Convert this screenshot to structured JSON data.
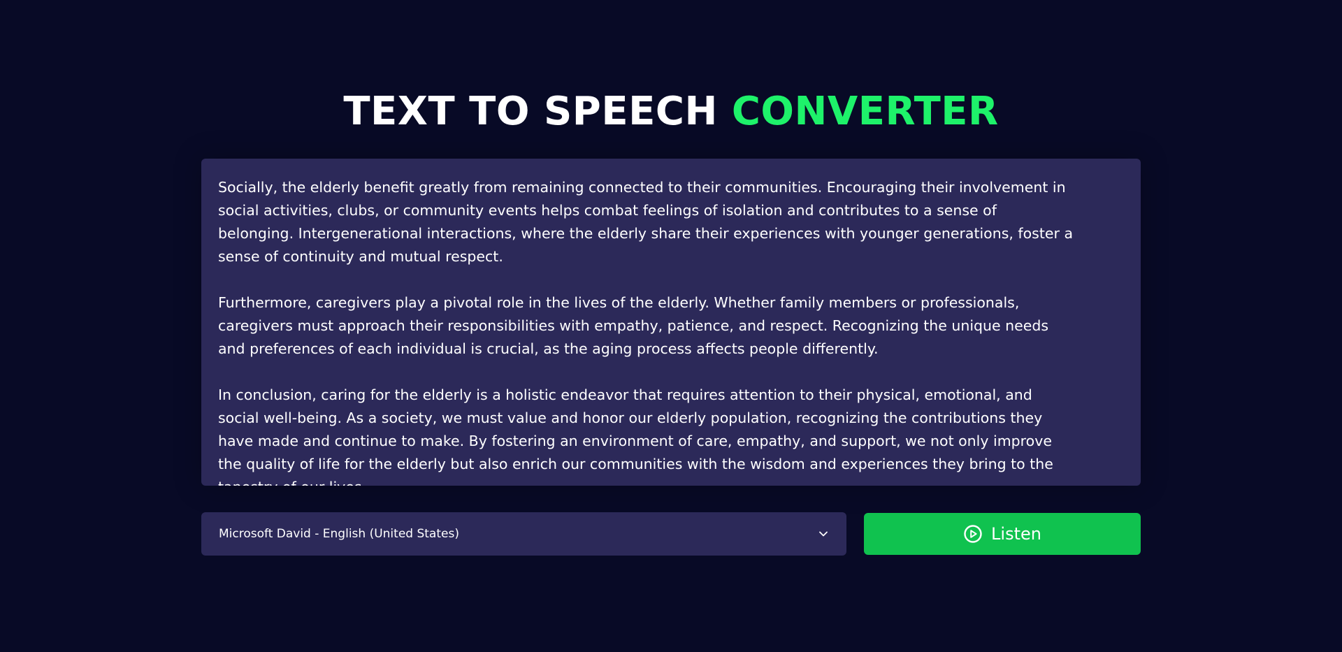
{
  "header": {
    "title_main": "TEXT TO SPEECH ",
    "title_accent": "CONVERTER"
  },
  "editor": {
    "text": "Socially, the elderly benefit greatly from remaining connected to their communities. Encouraging their involvement in\nsocial activities, clubs, or community events helps combat feelings of isolation and contributes to a sense of\nbelonging. Intergenerational interactions, where the elderly share their experiences with younger generations, foster a\nsense of continuity and mutual respect.\n\nFurthermore, caregivers play a pivotal role in the lives of the elderly. Whether family members or professionals,\ncaregivers must approach their responsibilities with empathy, patience, and respect. Recognizing the unique needs\nand preferences of each individual is crucial, as the aging process affects people differently.\n\nIn conclusion, caring for the elderly is a holistic endeavor that requires attention to their physical, emotional, and\nsocial well-being. As a society, we must value and honor our elderly population, recognizing the contributions they\nhave made and continue to make. By fostering an environment of care, empathy, and support, we not only improve\nthe quality of life for the elderly but also enrich our communities with the wisdom and experiences they bring to the\ntapestry of our lives."
  },
  "controls": {
    "voice_selected": "Microsoft David - English (United States)",
    "listen_label": "Listen"
  },
  "colors": {
    "background": "#080a26",
    "panel": "#2c2959",
    "accent": "#1ef26a",
    "button": "#10c24f"
  }
}
